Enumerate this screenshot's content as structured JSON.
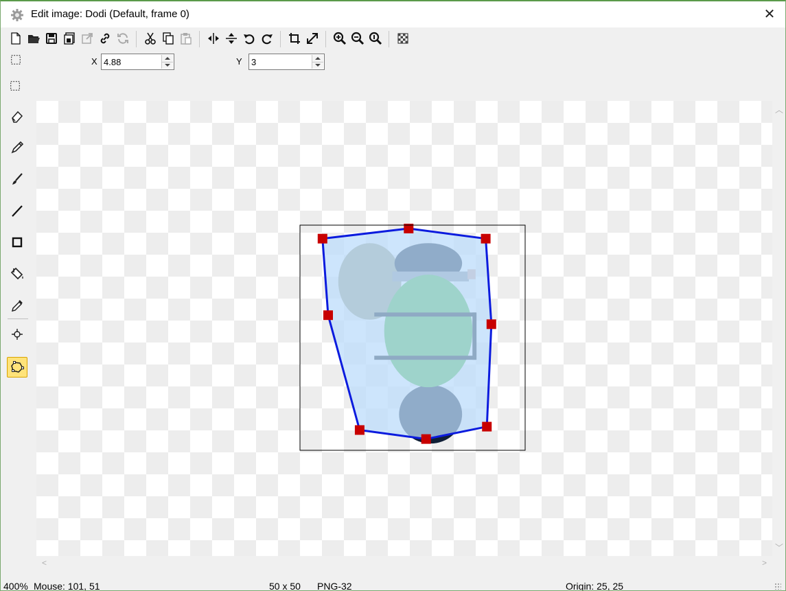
{
  "window": {
    "title": "Edit image: Dodi (Default, frame 0)",
    "close_symbol": "✕"
  },
  "toolbar": {
    "buttons": [
      "new-icon",
      "open-icon",
      "save-icon",
      "save-as-icon",
      "export-icon",
      "link-icon",
      "reload-icon",
      "cut-icon",
      "copy-icon",
      "paste-icon",
      "flip-horizontal-icon",
      "flip-vertical-icon",
      "rotate-ccw-icon",
      "rotate-cw-icon",
      "crop-icon",
      "resize-icon",
      "zoom-in-icon",
      "zoom-out-icon",
      "zoom-reset-icon",
      "transparency-icon"
    ]
  },
  "options": {
    "x_label": "X",
    "x_value": "4.88",
    "y_label": "Y",
    "y_value": "3"
  },
  "tools": [
    "select-icon",
    "eraser-icon",
    "pencil-icon",
    "brush-icon",
    "line-icon",
    "rectangle-icon",
    "fill-icon",
    "eyedropper-icon",
    "origin-icon",
    "polygon-mask-icon"
  ],
  "active_tool": "polygon-mask-icon",
  "image": {
    "width": 50,
    "height": 50,
    "zoom_percent": 400,
    "origin": [
      25,
      25
    ],
    "mask_polygon": [
      [
        24.13,
        0.75
      ],
      [
        41.25,
        3
      ],
      [
        42.5,
        22
      ],
      [
        41.5,
        44.75
      ],
      [
        28,
        47.5
      ],
      [
        13.25,
        45.5
      ],
      [
        6.25,
        20
      ],
      [
        5,
        3
      ]
    ]
  },
  "status": {
    "zoom": "400%",
    "mouse": "Mouse: 101, 51",
    "size": "50 x 50",
    "format": "PNG-32",
    "origin": "Origin: 25, 25"
  },
  "colors": {
    "mask_line": "#0b1bde",
    "mask_fill": "#bcdcfb",
    "vertex": "#c80000",
    "active_tool_bg": "#ffe37a",
    "green_body": "#46b83c"
  }
}
